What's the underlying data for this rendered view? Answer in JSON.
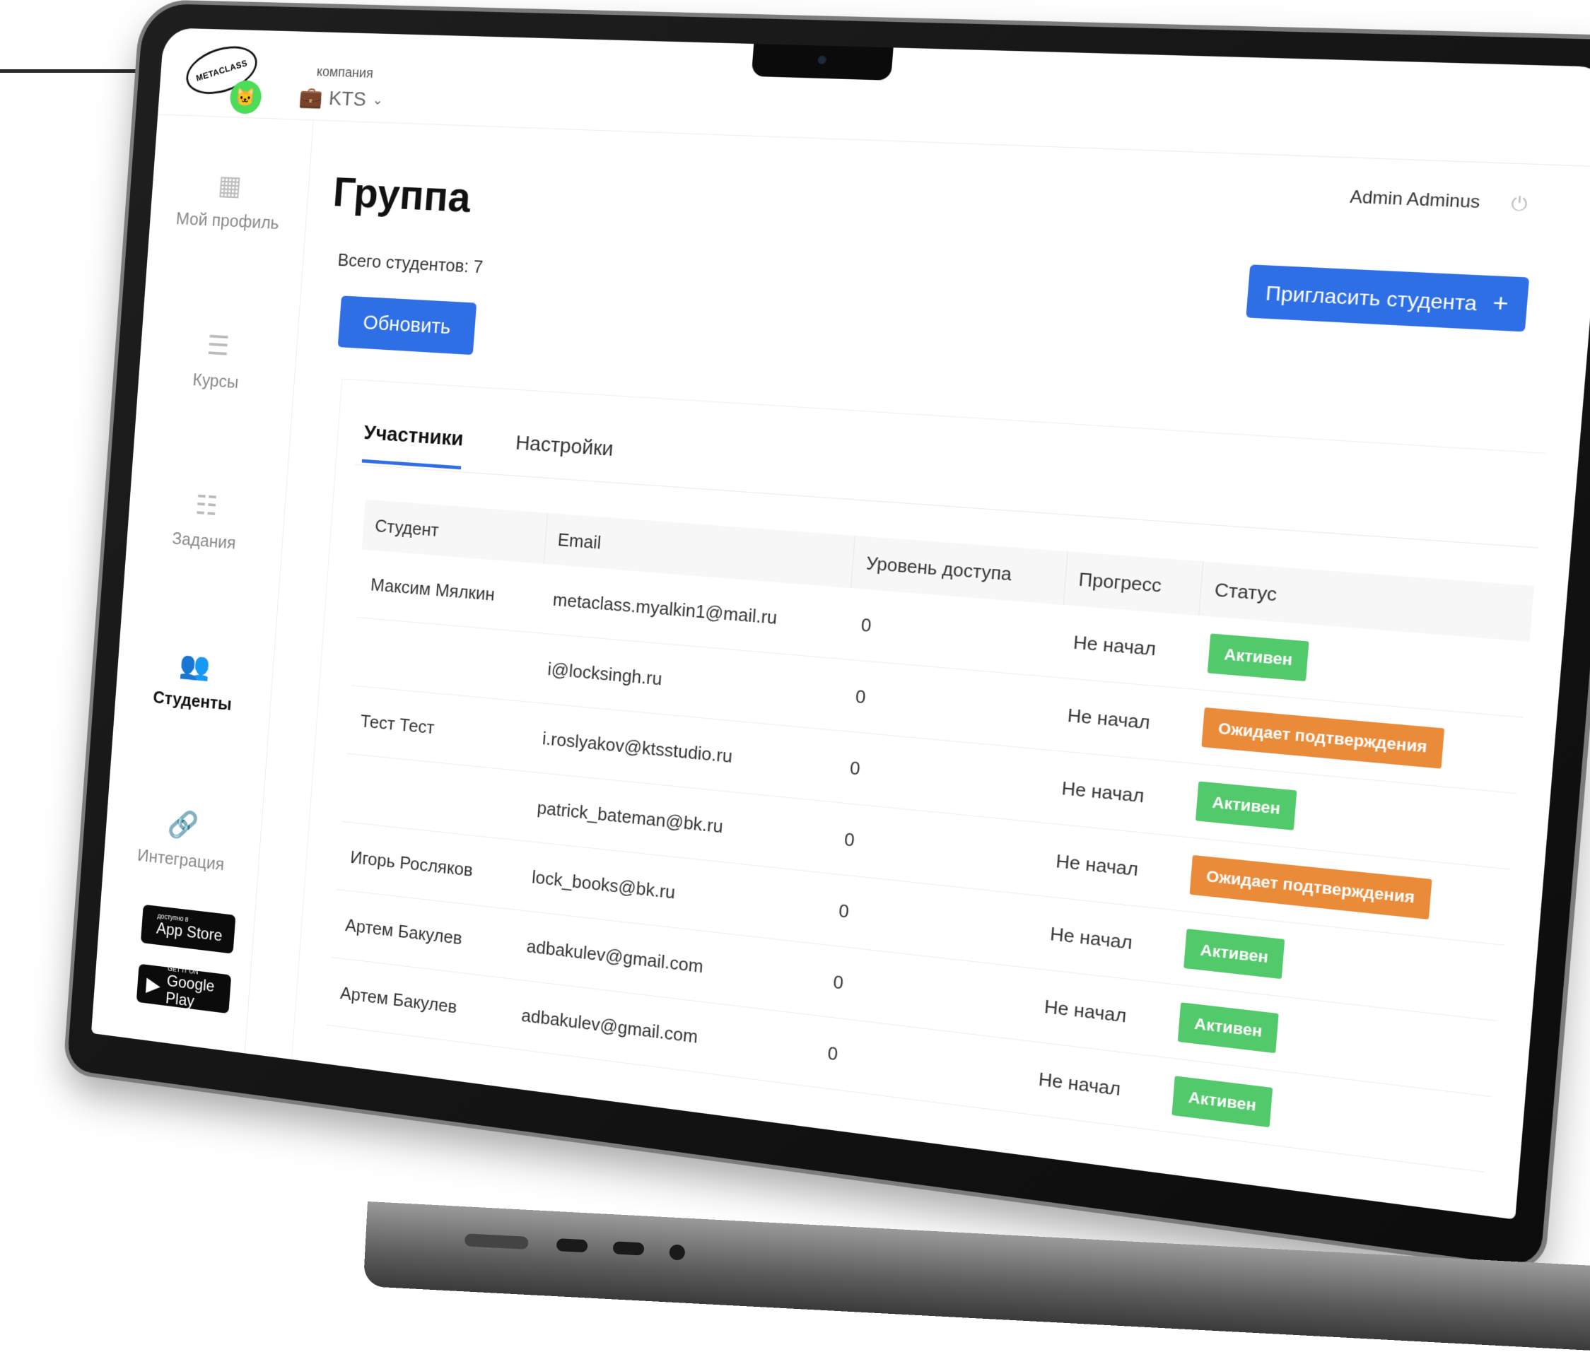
{
  "brand": {
    "logo_text": "METACLASS"
  },
  "company": {
    "label": "компания",
    "value": "KTS"
  },
  "user": {
    "name": "Admin Adminus"
  },
  "sidebar": {
    "items": [
      {
        "label": "Мой профиль",
        "icon": "dashboard-icon"
      },
      {
        "label": "Курсы",
        "icon": "list-icon"
      },
      {
        "label": "Задания",
        "icon": "tasks-icon"
      },
      {
        "label": "Студенты",
        "icon": "users-icon",
        "active": true
      },
      {
        "label": "Интеграция",
        "icon": "link-icon"
      }
    ],
    "stores": [
      {
        "small": "доступно в",
        "big": "App Store"
      },
      {
        "small": "GET IT ON",
        "big": "Google Play"
      }
    ]
  },
  "page": {
    "title": "Группа",
    "total_students": "Всего студентов: 7",
    "refresh_label": "Обновить",
    "invite_label": "Пригласить студента",
    "invite_plus": "+"
  },
  "tabs": [
    {
      "label": "Участники",
      "active": true
    },
    {
      "label": "Настройки",
      "active": false
    }
  ],
  "table": {
    "headers": [
      "Студент",
      "Email",
      "Уровень доступа",
      "Прогресс",
      "Статус"
    ],
    "rows": [
      {
        "name": "Максим Мялкин",
        "email": "metaclass.myalkin1@mail.ru",
        "level": "0",
        "progress": "Не начал",
        "status": "Активен",
        "kind": "active"
      },
      {
        "name": "",
        "email": "i@locksingh.ru",
        "level": "0",
        "progress": "Не начал",
        "status": "Ожидает подтверждения",
        "kind": "pending"
      },
      {
        "name": "Тест Тест",
        "email": "i.roslyakov@ktsstudio.ru",
        "level": "0",
        "progress": "Не начал",
        "status": "Активен",
        "kind": "active"
      },
      {
        "name": "",
        "email": "patrick_bateman@bk.ru",
        "level": "0",
        "progress": "Не начал",
        "status": "Ожидает подтверждения",
        "kind": "pending"
      },
      {
        "name": "Игорь Росляков",
        "email": "lock_books@bk.ru",
        "level": "0",
        "progress": "Не начал",
        "status": "Активен",
        "kind": "active"
      },
      {
        "name": "Артем Бакулев",
        "email": "adbakulev@gmail.com",
        "level": "0",
        "progress": "Не начал",
        "status": "Активен",
        "kind": "active"
      },
      {
        "name": "Артем Бакулев",
        "email": "adbakulev@gmail.com",
        "level": "0",
        "progress": "Не начал",
        "status": "Активен",
        "kind": "active"
      }
    ]
  },
  "colors": {
    "accent": "#2f6fe6",
    "active": "#52c96b",
    "pending": "#ea8b3a",
    "logo_badge": "#4ddb5a"
  }
}
